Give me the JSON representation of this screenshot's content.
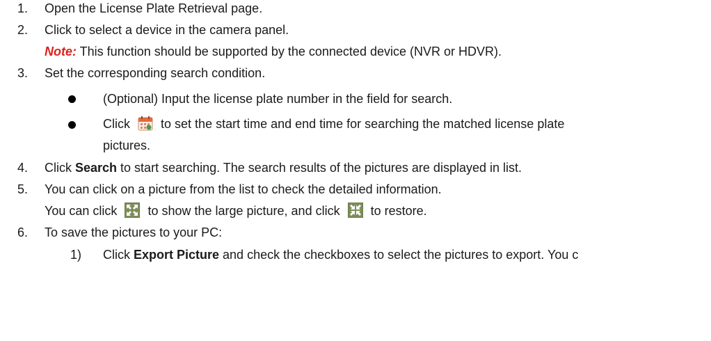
{
  "steps": [
    {
      "num": "1.",
      "text": "Open the License Plate Retrieval page."
    },
    {
      "num": "2.",
      "text": "Click to select a device in the camera panel."
    },
    {
      "num": "3.",
      "text": "Set the corresponding search condition."
    },
    {
      "num": "4.",
      "click": "Click ",
      "bold": "Search",
      "rest": " to start searching. The search results of the pictures are displayed in list."
    },
    {
      "num": "5.",
      "text": "You can click on a picture from the list to check the detailed information."
    },
    {
      "num": "6.",
      "text": "To save the pictures to your PC:"
    }
  ],
  "note": {
    "label": "Note:",
    "text": " This function should be supported by the connected device (NVR or HDVR)."
  },
  "bullets": [
    {
      "text": "(Optional) Input the license plate number in the field for search."
    },
    {
      "before": "Click",
      "icon": "calendar-icon",
      "after": "to set the start time and end time for searching the matched license plate",
      "continuation": "pictures."
    }
  ],
  "step5_line2": {
    "a": "You can click",
    "icon1": "fullscreen-icon",
    "b": "to show the large picture, and click",
    "icon2": "restore-icon",
    "c": "to restore."
  },
  "substep": {
    "num": "1)",
    "click": "Click ",
    "bold": "Export Picture",
    "rest": " and check the checkboxes to select the pictures to export. You c"
  }
}
